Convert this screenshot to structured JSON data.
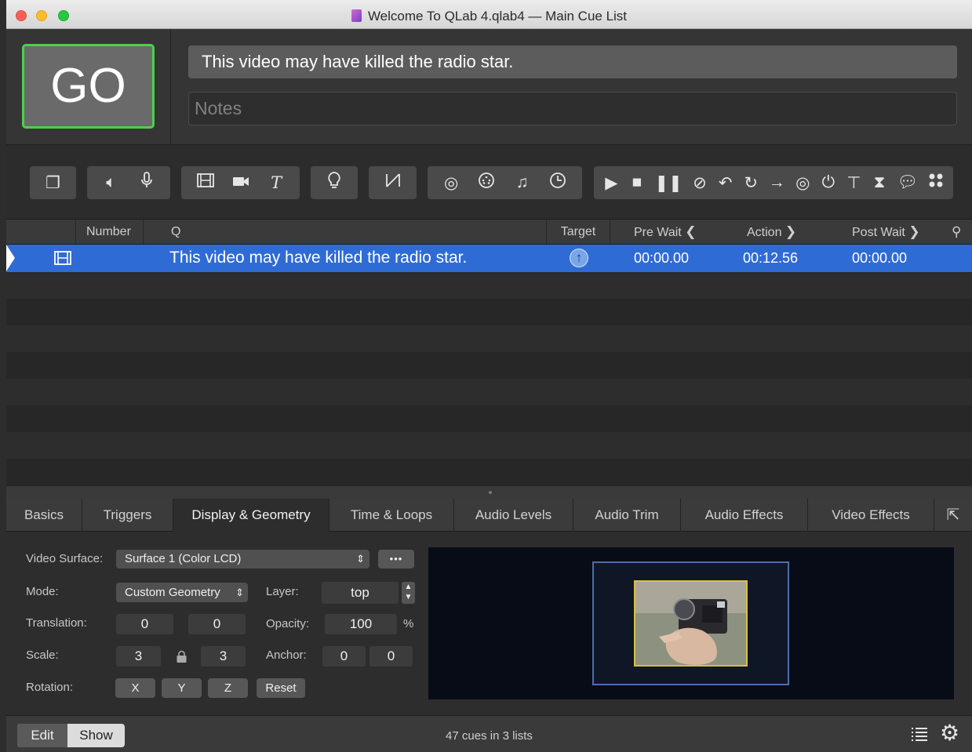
{
  "window": {
    "title": "Welcome To QLab 4.qlab4 — Main Cue List"
  },
  "go": {
    "label": "GO"
  },
  "cue_header": {
    "name": "This video may have killed the radio star.",
    "notes_placeholder": "Notes"
  },
  "columns": {
    "number": "Number",
    "q": "Q",
    "target": "Target",
    "pre_wait": "Pre Wait",
    "action": "Action",
    "post_wait": "Post Wait"
  },
  "cues": [
    {
      "name": "This video may have killed the radio star.",
      "pre_wait": "00:00.00",
      "action": "00:12.56",
      "post_wait": "00:00.00"
    }
  ],
  "tabs": [
    "Basics",
    "Triggers",
    "Display & Geometry",
    "Time & Loops",
    "Audio Levels",
    "Audio Trim",
    "Audio Effects",
    "Video Effects"
  ],
  "inspector": {
    "video_surface_label": "Video Surface:",
    "video_surface_value": "Surface 1 (Color LCD)",
    "more": "•••",
    "mode_label": "Mode:",
    "mode_value": "Custom Geometry",
    "layer_label": "Layer:",
    "layer_value": "top",
    "translation_label": "Translation:",
    "translation_x": "0",
    "translation_y": "0",
    "opacity_label": "Opacity:",
    "opacity_value": "100",
    "opacity_unit": "%",
    "scale_label": "Scale:",
    "scale_x": "3",
    "scale_y": "3",
    "anchor_label": "Anchor:",
    "anchor_x": "0",
    "anchor_y": "0",
    "rotation_label": "Rotation:",
    "rot_x": "X",
    "rot_y": "Y",
    "rot_z": "Z",
    "reset": "Reset"
  },
  "status": {
    "edit": "Edit",
    "show": "Show",
    "count": "47 cues in 3 lists"
  }
}
